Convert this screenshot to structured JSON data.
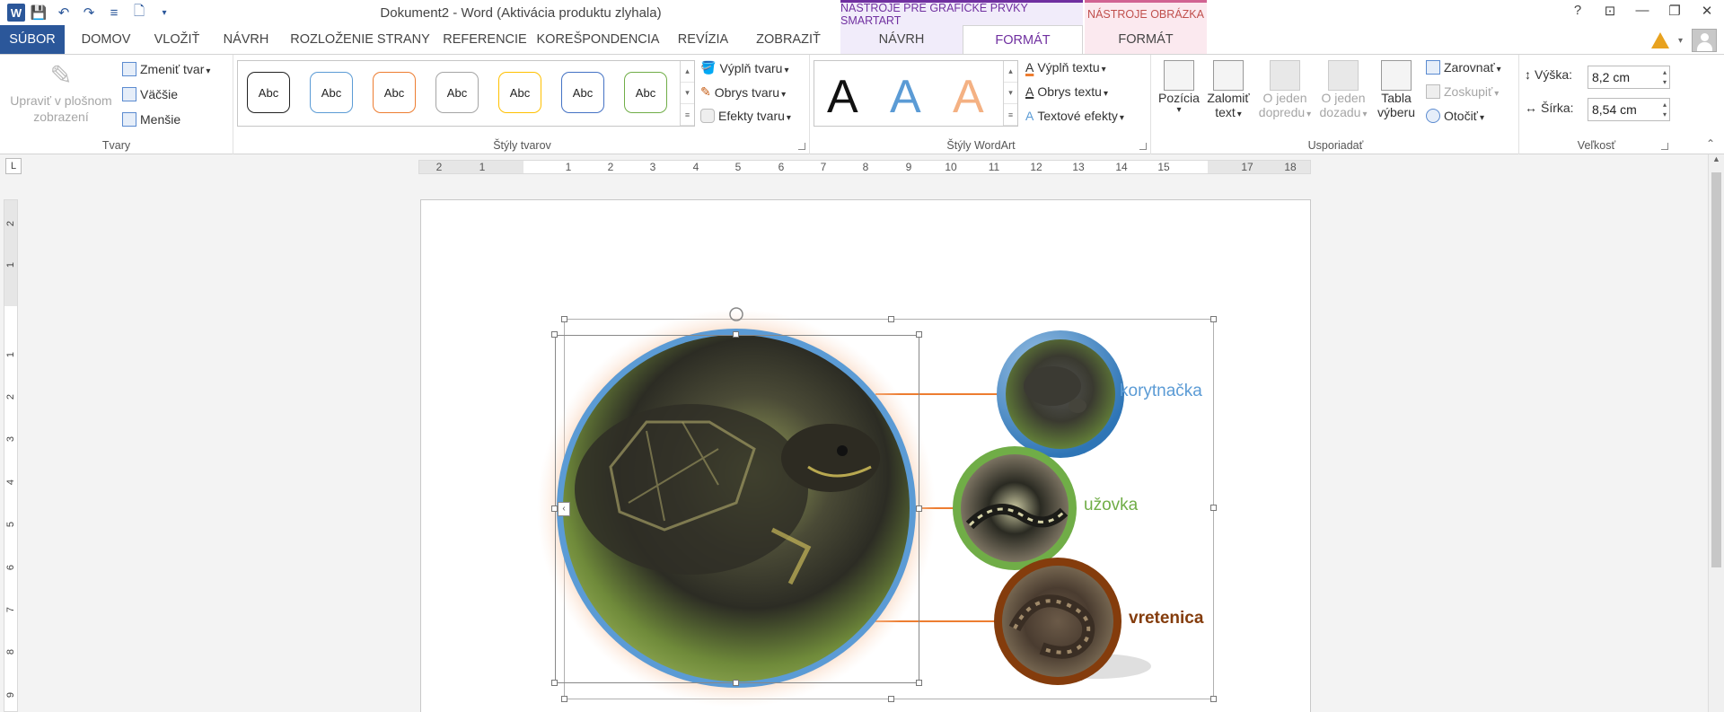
{
  "titlebar": {
    "title": "Dokument2 - Word (Aktivácia produktu zlyhala)",
    "context_smartart": "NÁSTROJE PRE GRAFICKÉ PRVKY SMARTART",
    "context_picture": "NÁSTROJE OBRÁZKA",
    "help": "?",
    "qat": {
      "save": "💾",
      "undo": "↶",
      "redo": "↷",
      "touch": "≡",
      "new": "🗋",
      "more": "▾"
    },
    "logo": "W"
  },
  "tabs": {
    "file": "SÚBOR",
    "home": "DOMOV",
    "insert": "VLOŽIŤ",
    "design": "NÁVRH",
    "layout": "ROZLOŽENIE STRANY",
    "references": "REFERENCIE",
    "mailings": "KOREŠPONDENCIA",
    "review": "REVÍZIA",
    "view": "ZOBRAZIŤ",
    "smart_design": "NÁVRH",
    "smart_format": "FORMÁT",
    "pic_format": "FORMÁT"
  },
  "ribbon": {
    "shapes": {
      "label": "Tvary",
      "edit_2d_line1": "Upraviť v plošnom",
      "edit_2d_line2": "zobrazení",
      "change_shape": "Zmeniť tvar",
      "larger": "Väčšie",
      "smaller": "Menšie"
    },
    "shape_styles": {
      "label": "Štýly tvarov",
      "sample": "Abc",
      "fill": "Výplň tvaru",
      "outline": "Obrys tvaru",
      "effects": "Efekty tvaru",
      "colors": [
        "#222222",
        "#5b9bd5",
        "#ed7d31",
        "#a5a5a5",
        "#ffc000",
        "#4472c4",
        "#70ad47"
      ]
    },
    "wordart": {
      "label": "Štýly WordArt",
      "letter": "A",
      "text_fill": "Výplň textu",
      "text_outline": "Obrys textu",
      "text_effects": "Textové efekty"
    },
    "arrange": {
      "label": "Usporiadať",
      "position": "Pozícia",
      "wrap_line1": "Zalomiť",
      "wrap_line2": "text",
      "forward_line1": "O jeden",
      "forward_line2": "dopredu",
      "backward_line1": "O jeden",
      "backward_line2": "dozadu",
      "pane_line1": "Tabla",
      "pane_line2": "výberu",
      "align": "Zarovnať",
      "group": "Zoskupiť",
      "rotate": "Otočiť"
    },
    "size": {
      "label": "Veľkosť",
      "height_label": "Výška:",
      "height_value": "8,2 cm",
      "width_label": "Šírka:",
      "width_value": "8,54 cm"
    }
  },
  "ruler": {
    "h_ticks": [
      "2",
      "1",
      "1",
      "2",
      "3",
      "4",
      "5",
      "6",
      "7",
      "8",
      "9",
      "10",
      "11",
      "12",
      "13",
      "14",
      "15",
      "17",
      "18"
    ],
    "v_ticks": [
      "2",
      "1",
      "1",
      "2",
      "3",
      "4",
      "5",
      "6",
      "7",
      "8",
      "9"
    ],
    "tab_selector": "L"
  },
  "smartart": {
    "items": [
      {
        "label": "korytnačka",
        "color": "#5b9bd5"
      },
      {
        "label": "užovka",
        "color": "#70ad47"
      },
      {
        "label": "vretenica",
        "color": "#843c0c"
      }
    ]
  }
}
